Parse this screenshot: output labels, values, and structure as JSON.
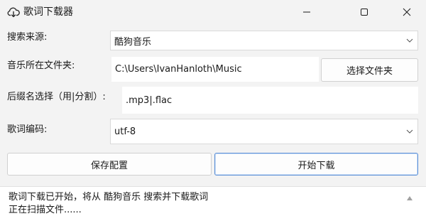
{
  "window": {
    "title": "歌词下载器",
    "icon": "cloud-download-icon"
  },
  "form": {
    "source_label": "搜索来源:",
    "source_value": "酷狗音乐",
    "folder_label": "音乐所在文件夹:",
    "folder_value": "C:\\Users\\IvanHanloth\\Music",
    "choose_folder_button": "选择文件夹",
    "suffix_label": "后缀名选择（用|分割）:",
    "suffix_value": ".mp3|.flac",
    "encoding_label": "歌词编码:",
    "encoding_value": "utf-8"
  },
  "actions": {
    "save_config": "保存配置",
    "start_download": "开始下载"
  },
  "log": {
    "lines": [
      "歌词下载已开始，将从 酷狗音乐 搜索并下载歌词",
      "正在扫描文件......"
    ]
  },
  "colors": {
    "primary_border": "#5b8fd6",
    "window_bg": "#f3f3f3"
  }
}
